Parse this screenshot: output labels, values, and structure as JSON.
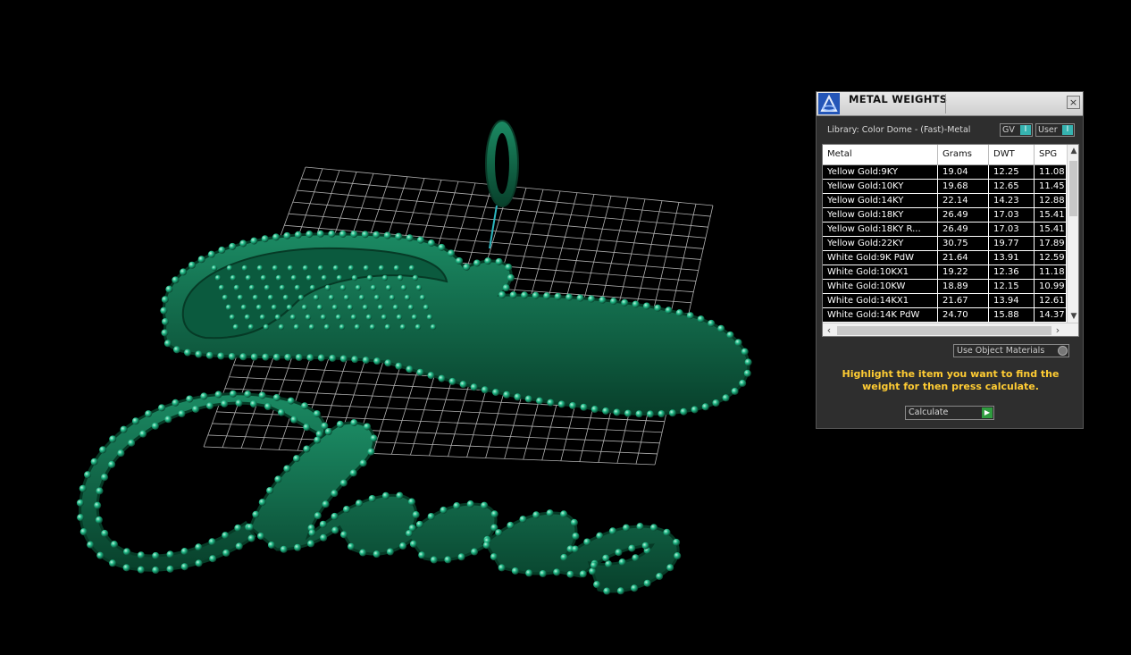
{
  "colors": {
    "background": "#000000",
    "metal_green": "#0f6a4a",
    "gem_green": "#1fb886",
    "grid": "#cfcfcf",
    "hint_text": "#ffcc33",
    "toggle_accent": "#36b3b0"
  },
  "viewport": {
    "scene": "two jewelry 'Chana' script pendants rendered in green over a white grid plane"
  },
  "panel": {
    "title": "METAL WEIGHTS",
    "close_icon": "×",
    "library_label": "Library: Color Dome - (Fast)-Metal",
    "toggle_gv": "GV",
    "toggle_user": "User",
    "table": {
      "columns": [
        "Metal",
        "Grams",
        "DWT",
        "SPG"
      ],
      "rows": [
        [
          "Yellow Gold:9KY",
          "19.04",
          "12.25",
          "11.08"
        ],
        [
          "Yellow Gold:10KY",
          "19.68",
          "12.65",
          "11.45"
        ],
        [
          "Yellow Gold:14KY",
          "22.14",
          "14.23",
          "12.88"
        ],
        [
          "Yellow Gold:18KY",
          "26.49",
          "17.03",
          "15.41"
        ],
        [
          "Yellow Gold:18KY R...",
          "26.49",
          "17.03",
          "15.41"
        ],
        [
          "Yellow Gold:22KY",
          "30.75",
          "19.77",
          "17.89"
        ],
        [
          "White Gold:9K PdW",
          "21.64",
          "13.91",
          "12.59"
        ],
        [
          "White Gold:10KX1",
          "19.22",
          "12.36",
          "11.18"
        ],
        [
          "White Gold:10KW",
          "18.89",
          "12.15",
          "10.99"
        ],
        [
          "White Gold:14KX1",
          "21.67",
          "13.94",
          "12.61"
        ],
        [
          "White Gold:14K PdW",
          "24.70",
          "15.88",
          "14.37"
        ]
      ]
    },
    "use_object_materials": "Use Object Materials",
    "hint_text": "Highlight the item you want to find the weight for then press calculate.",
    "calculate_label": "Calculate"
  }
}
